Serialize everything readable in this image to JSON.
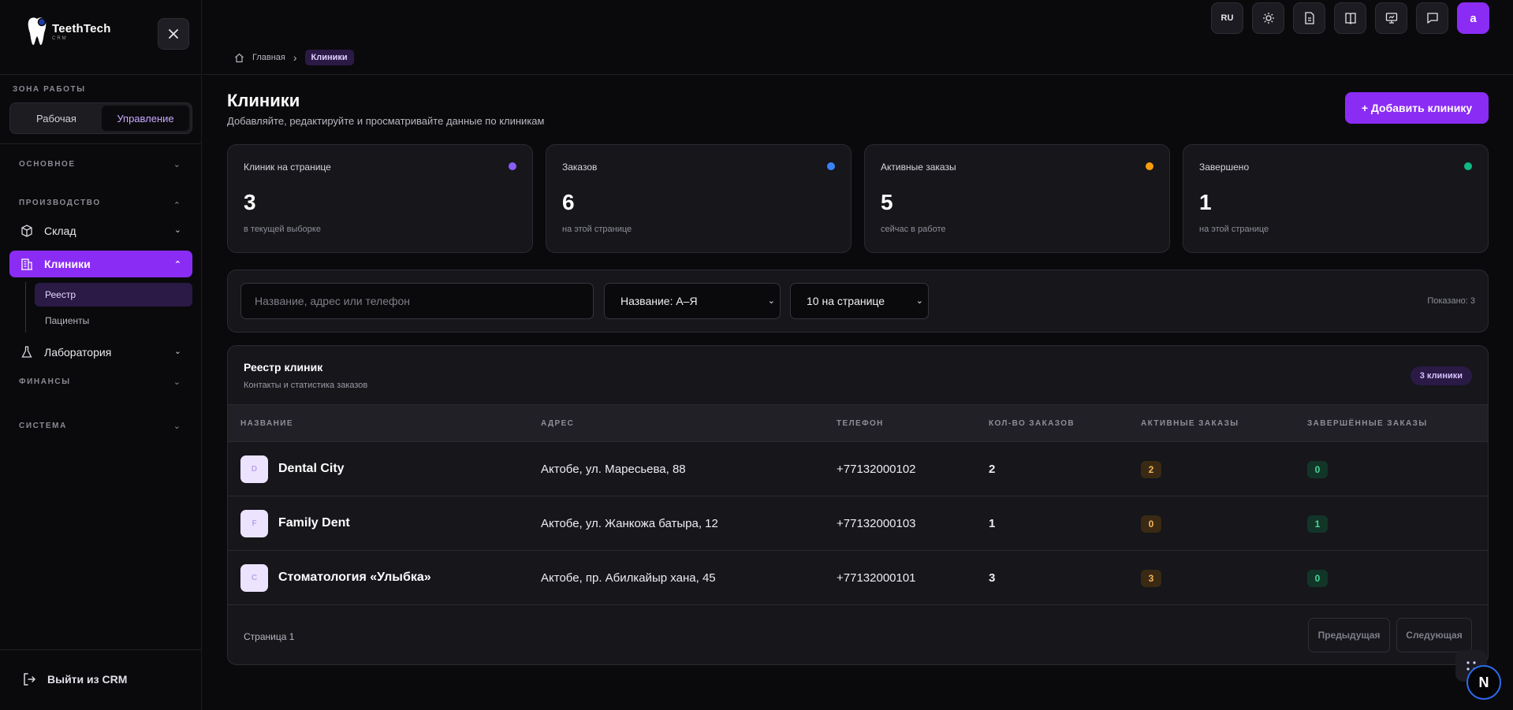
{
  "logo": {
    "brand": "TeethTech",
    "sub": "CRM"
  },
  "sidebar": {
    "zone_label": "ЗОНА РАБОТЫ",
    "zone_options": [
      "Рабочая",
      "Управление"
    ],
    "sections": {
      "main": "ОСНОВНОЕ",
      "production": "ПРОИЗВОДСТВО",
      "finance": "ФИНАНСЫ",
      "system": "СИСТЕМА"
    },
    "items": {
      "warehouse": "Склад",
      "clinics": "Клиники",
      "registry": "Реестр",
      "patients": "Пациенты",
      "lab": "Лаборатория"
    },
    "logout": "Выйти из CRM"
  },
  "topbar": {
    "lang": "RU",
    "avatar": "a",
    "breadcrumb": {
      "home": "Главная",
      "current": "Клиники"
    }
  },
  "page": {
    "title": "Клиники",
    "subtitle": "Добавляйте, редактируйте и просматривайте данные по клиникам",
    "add_button": "+ Добавить клинику"
  },
  "stats": [
    {
      "label": "Клиник на странице",
      "value": "3",
      "note": "в текущей выборке",
      "color": "#8b5cf6"
    },
    {
      "label": "Заказов",
      "value": "6",
      "note": "на этой странице",
      "color": "#3b82f6"
    },
    {
      "label": "Активные заказы",
      "value": "5",
      "note": "сейчас в работе",
      "color": "#f59e0b"
    },
    {
      "label": "Завершено",
      "value": "1",
      "note": "на этой странице",
      "color": "#10b981"
    }
  ],
  "filters": {
    "search_placeholder": "Название, адрес или телефон",
    "sort": "Название: А–Я",
    "per_page": "10 на странице",
    "shown": "Показано: 3"
  },
  "table": {
    "title": "Реестр клиник",
    "subtitle": "Контакты и статистика заказов",
    "badge": "3 клиники",
    "columns": [
      "НАЗВАНИЕ",
      "АДРЕС",
      "ТЕЛЕФОН",
      "КОЛ-ВО ЗАКАЗОВ",
      "АКТИВНЫЕ ЗАКАЗЫ",
      "ЗАВЕРШЁННЫЕ ЗАКАЗЫ"
    ],
    "rows": [
      {
        "initial": "D",
        "name": "Dental City",
        "address": "Актобе, ул. Маресьева, 88",
        "phone": "+77132000102",
        "orders": "2",
        "active": "2",
        "done": "0"
      },
      {
        "initial": "F",
        "name": "Family Dent",
        "address": "Актобе, ул. Жанкожа батыра, 12",
        "phone": "+77132000103",
        "orders": "1",
        "active": "0",
        "done": "1"
      },
      {
        "initial": "С",
        "name": "Стоматология «Улыбка»",
        "address": "Актобе, пр. Абилкайыр хана, 45",
        "phone": "+77132000101",
        "orders": "3",
        "active": "3",
        "done": "0"
      }
    ],
    "page": "Страница 1",
    "prev": "Предыдущая",
    "next": "Следующая"
  },
  "fab": {
    "label": "N"
  }
}
